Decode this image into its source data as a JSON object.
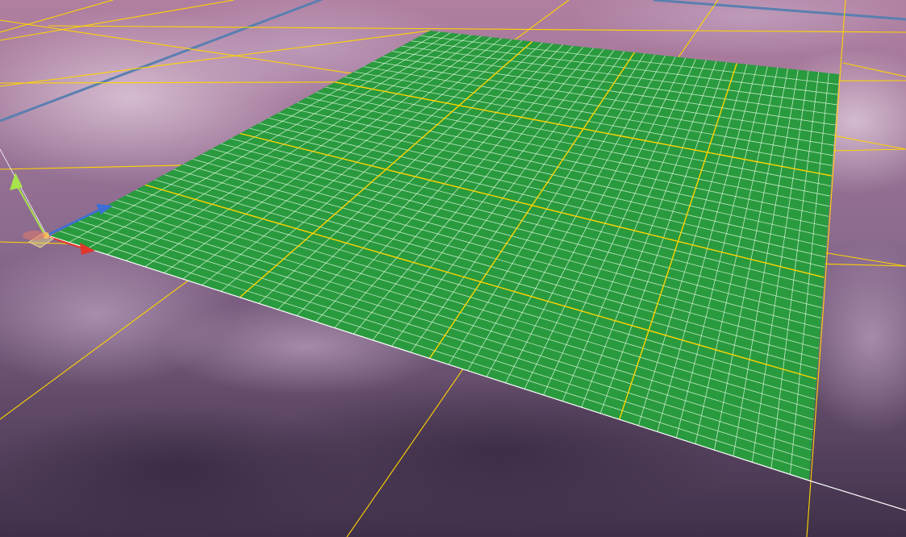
{
  "viewport": {
    "sky_top_color": "#b07fa0",
    "sky_mid_color": "#8a6a8e",
    "sky_bottom_color": "#3f3049",
    "cloud_color": "#d7bfd4"
  },
  "scene_grid": {
    "line_color": "#ffd400",
    "label": ""
  },
  "axis_line": {
    "color": "#5a7fb0"
  },
  "plane": {
    "fill_color": "#2a9a3f",
    "fine_grid_color": "#d9f7d9",
    "coarse_grid_color": "#ffd400",
    "edge_color": "#ffffff",
    "fine_subdivisions": 40,
    "coarse_subdivisions": 4
  },
  "transform_gizmo": {
    "x_axis": {
      "color": "#e0372a",
      "icon": "arrow-x-icon"
    },
    "y_axis": {
      "color": "#a7e34a",
      "icon": "arrow-y-icon"
    },
    "z_axis": {
      "color": "#3a6fd8",
      "icon": "arrow-z-icon"
    },
    "pivot_icon": "pivot-square-icon"
  }
}
